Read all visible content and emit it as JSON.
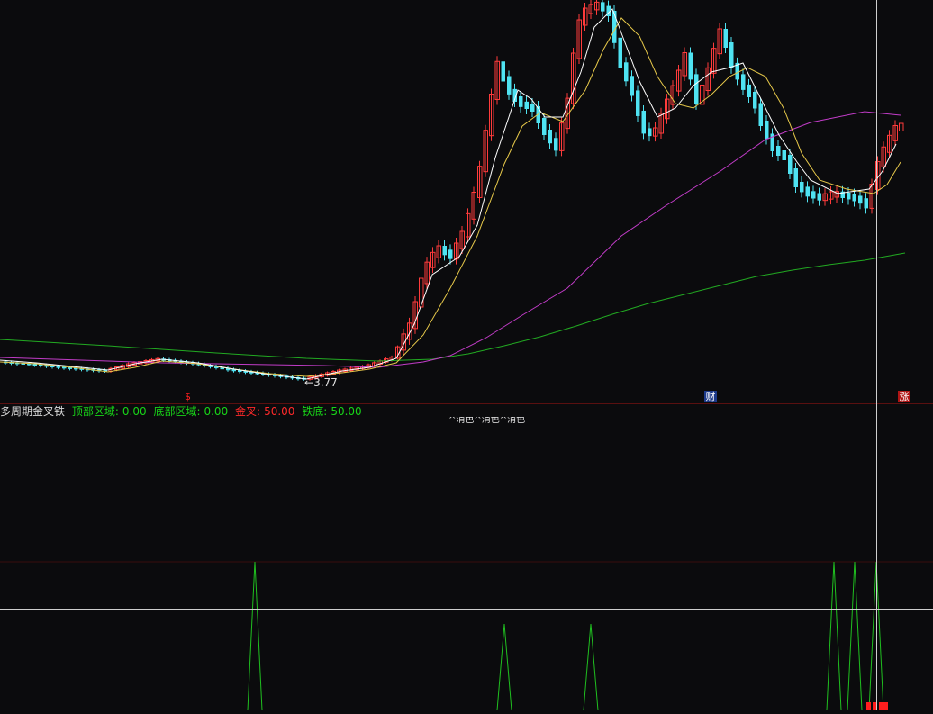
{
  "indicator": {
    "name": "多周期金叉铁",
    "top_zone_label": "顶部区域:",
    "top_zone_value": "0.00",
    "bottom_zone_label": "底部区域:",
    "bottom_zone_value": "0.00",
    "golden_cross_label": "金叉:",
    "golden_cross_value": "50.00",
    "iron_bottom_label": "铁底:",
    "iron_bottom_value": "50.00",
    "partial_caption": "^消色^消色^消色"
  },
  "price_chart": {
    "low_label": "3.77",
    "markers": {
      "s": "$",
      "cai": "财",
      "zhang": "涨"
    },
    "colors": {
      "up": "#ff3b3b",
      "down": "#4fe3f2",
      "ma_white": "#ffffff",
      "ma_yellow": "#e6c84a",
      "ma_magenta": "#c23cc8",
      "ma_green": "#22aa22",
      "indicator_spike": "#20c020",
      "indicator_bar": "#ff1e1e"
    }
  }
}
